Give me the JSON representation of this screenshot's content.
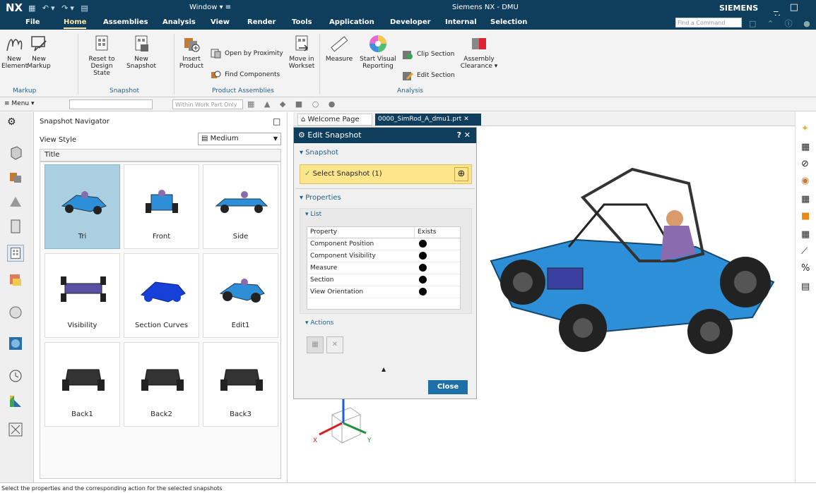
{
  "titlebar": {
    "logo": "NX",
    "window_menu": "Window ▾ ≡",
    "title": "Siemens NX - DMU",
    "brand": "SIEMENS",
    "controls": "_ □ ✕"
  },
  "menu": {
    "tabs": [
      "File",
      "Home",
      "Assemblies",
      "Analysis",
      "View",
      "Render",
      "Tools",
      "Application",
      "Developer",
      "Internal",
      "Selection"
    ],
    "find_placeholder": "Find a Command"
  },
  "ribbon": {
    "new_element": "New Element",
    "new_markup": "New Markup",
    "reset_to_design": "Reset to Design State",
    "new_snapshot": "New Snapshot",
    "insert_product": "Insert Product",
    "open_by_proximity": "Open by Proximity",
    "find_components": "Find Components",
    "move_in_workset": "Move in Workset",
    "measure": "Measure",
    "start_visual_reporting": "Start Visual Reporting",
    "clip_section": "Clip Section",
    "edit_section": "Edit Section",
    "assembly_clearance": "Assembly Clearance ▾",
    "groups": {
      "markup": "Markup",
      "snapshot": "Snapshot",
      "product_assemblies": "Product Assemblies",
      "analysis": "Analysis"
    }
  },
  "toolbar": {
    "menu": "≡ Menu ▾",
    "filter": "Within Work Part Only"
  },
  "navigator": {
    "title": "Snapshot Navigator",
    "view_style_label": "View Style",
    "view_style_value": "Medium",
    "column_title": "Title",
    "snapshots": [
      "Tri",
      "Front",
      "Side",
      "Visibility",
      "Section Curves",
      "Edit1",
      "Back1",
      "Back2",
      "Back3"
    ]
  },
  "doctabs": {
    "welcome": "Welcome Page",
    "part": "0000_SimRod_A_dmu1.prt"
  },
  "dialog": {
    "title": "Edit Snapshot",
    "help": "? ✕",
    "snapshot_section": "Snapshot",
    "select_snapshot": "Select Snapshot (1)",
    "properties_section": "Properties",
    "list_section": "List",
    "col_property": "Property",
    "col_exists": "Exists",
    "rows": [
      "Component Position",
      "Component Visibility",
      "Measure",
      "Section",
      "View Orientation"
    ],
    "actions_section": "Actions",
    "close": "Close"
  },
  "triad": {
    "x": "X",
    "y": "Y"
  },
  "status": "Select the properties and the corresponding action for the selected snapshots",
  "colors": {
    "titlebar": "#0f3d5c",
    "selected": "#a9cfe0",
    "highlight": "#fce58a",
    "car_blue": "#2d8fd8"
  }
}
